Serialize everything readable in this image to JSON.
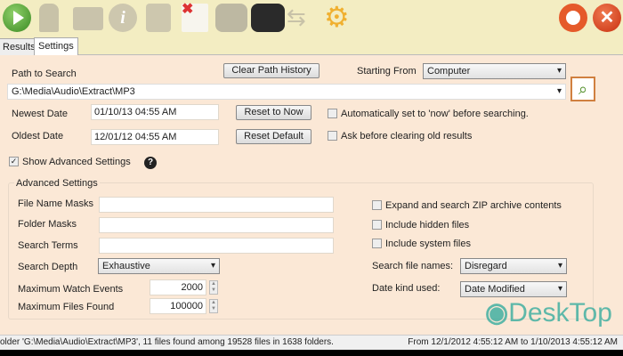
{
  "toolbar": {
    "icons": [
      "play-icon",
      "rocket-icon",
      "folder-icon",
      "info-icon",
      "clipboard-icon",
      "delete-document-icon",
      "binoculars-disabled-icon",
      "binoculars-icon",
      "swap-arrows-icon",
      "gear-icon",
      "lifebuoy-icon",
      "close-icon"
    ]
  },
  "tabs": [
    {
      "label": "Results"
    },
    {
      "label": "Settings",
      "active": true
    }
  ],
  "settings": {
    "path_label": "Path to Search",
    "clear_path_history": "Clear Path History",
    "starting_from_label": "Starting From",
    "starting_from_value": "Computer",
    "path_value": "G:\\Media\\Audio\\Extract\\MP3",
    "newest_label": "Newest Date",
    "newest_value": "01/10/13 04:55 AM",
    "reset_now": "Reset to Now",
    "auto_now_label": "Automatically set to 'now' before searching.",
    "auto_now_checked": false,
    "oldest_label": "Oldest Date",
    "oldest_value": "12/01/12 04:55 AM",
    "reset_default": "Reset Default",
    "ask_clear_label": "Ask before clearing old results",
    "ask_clear_checked": false,
    "show_advanced_label": "Show Advanced Settings",
    "show_advanced_checked": true,
    "help": "?"
  },
  "advanced": {
    "title": "Advanced Settings",
    "file_masks_label": "File Name Masks",
    "file_masks_value": "",
    "folder_masks_label": "Folder Masks",
    "folder_masks_value": "",
    "search_terms_label": "Search Terms",
    "search_terms_value": "",
    "depth_label": "Search Depth",
    "depth_value": "Exhaustive",
    "max_watch_label": "Maximum Watch Events",
    "max_watch_value": "2000",
    "max_files_label": "Maximum Files Found",
    "max_files_value": "100000",
    "zip_label": "Expand and search ZIP archive contents",
    "hidden_label": "Include hidden files",
    "system_label": "Include system files",
    "search_names_label": "Search file names:",
    "search_names_value": "Disregard",
    "date_kind_label": "Date kind used:",
    "date_kind_value": "Date Modified"
  },
  "status": {
    "left": "older 'G:\\Media\\Audio\\Extract\\MP3', 11 files found among 19528 files in 1638 folders.",
    "right": "From 12/1/2012 4:55:12 AM to 1/10/2013 4:55:12 AM"
  },
  "watermark": "DeskTop"
}
